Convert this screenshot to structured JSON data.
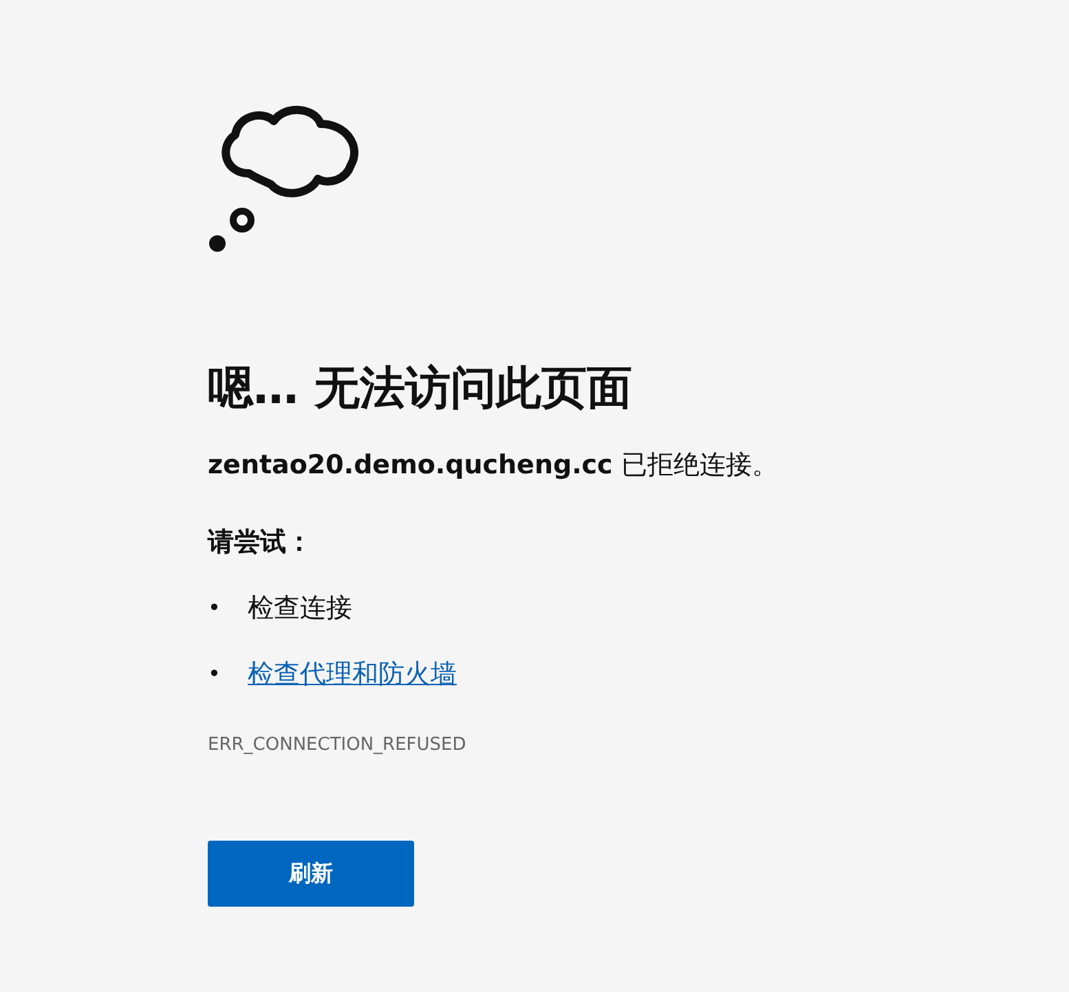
{
  "error_page": {
    "heading": "嗯… 无法访问此页面",
    "message": "**zentao20.demo.qucheng.cc** 已拒绝连接。",
    "suggestions_title": "请尝试：",
    "suggestions": [
      {
        "bullet": "•",
        "kind": "text",
        "text": "检查连接"
      },
      {
        "bullet": "•",
        "kind": "link",
        "text": "检查代理和防火墙"
      }
    ],
    "error_code": "ERR_CONNECTION_REFUSED",
    "button": "刷新"
  }
}
